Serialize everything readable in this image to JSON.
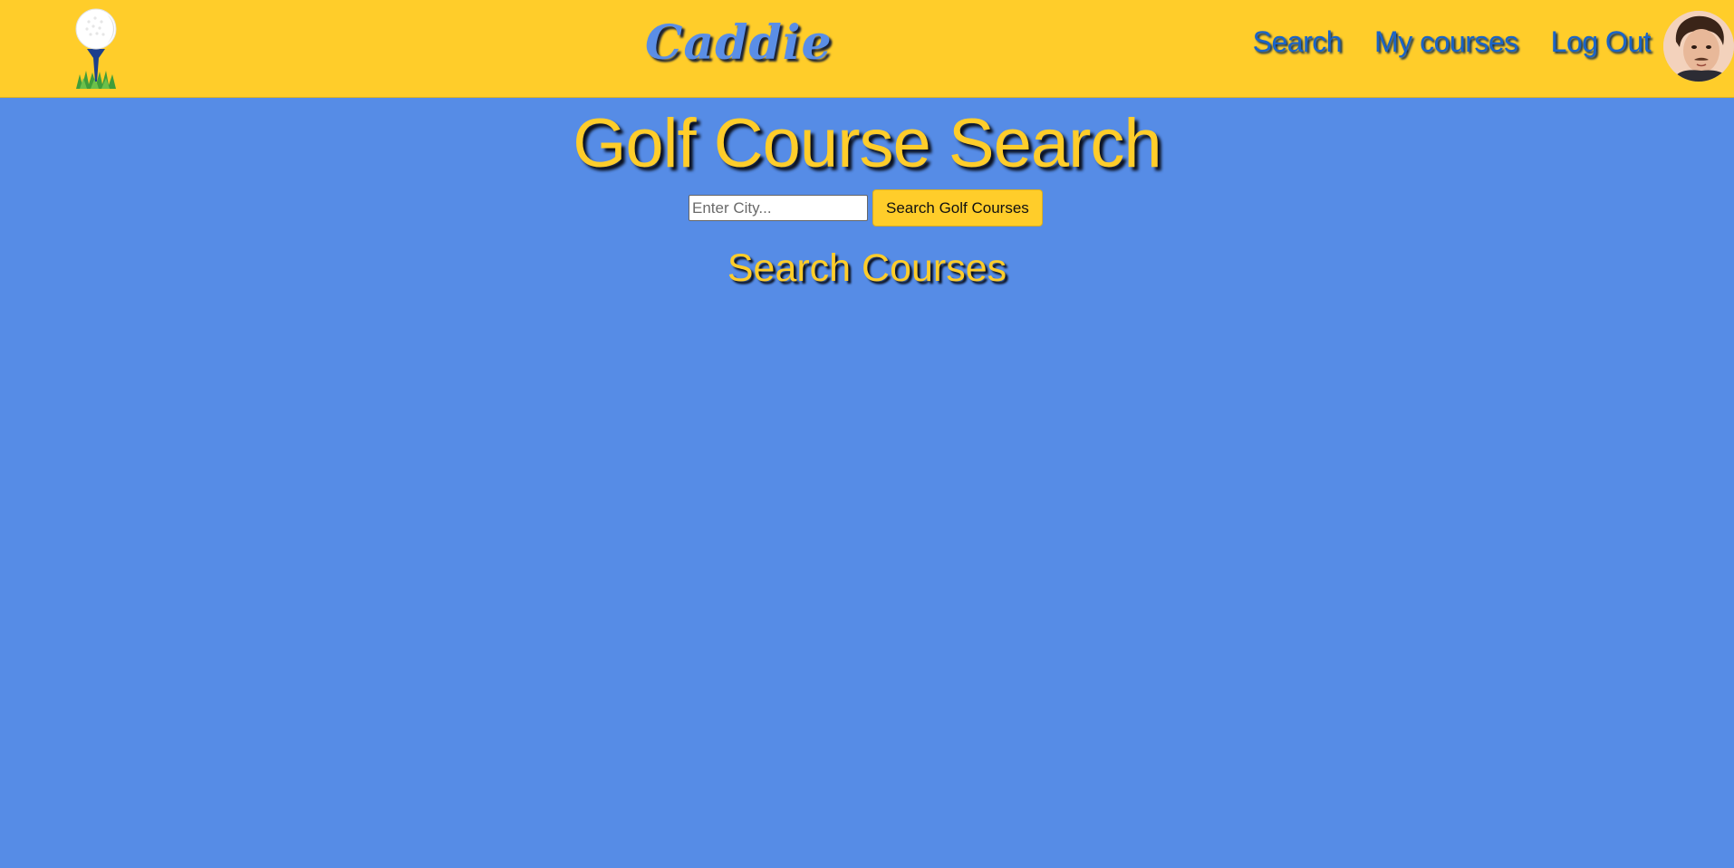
{
  "navbar": {
    "logo_icon": "golf-ball-on-tee-icon",
    "brand": "Caddie",
    "links": [
      {
        "label": "Search"
      },
      {
        "label": "My courses"
      },
      {
        "label": "Log Out"
      }
    ],
    "avatar": "user-avatar-photo"
  },
  "main": {
    "title": "Golf Course Search",
    "search": {
      "placeholder": "Enter City...",
      "value": "",
      "button_label": "Search Golf Courses"
    },
    "results_title": "Search Courses"
  },
  "colors": {
    "navbar_bg": "#ffcd2a",
    "page_bg": "#568ce6",
    "accent_yellow": "#ffcd2a",
    "link_blue": "#1a64c8"
  }
}
